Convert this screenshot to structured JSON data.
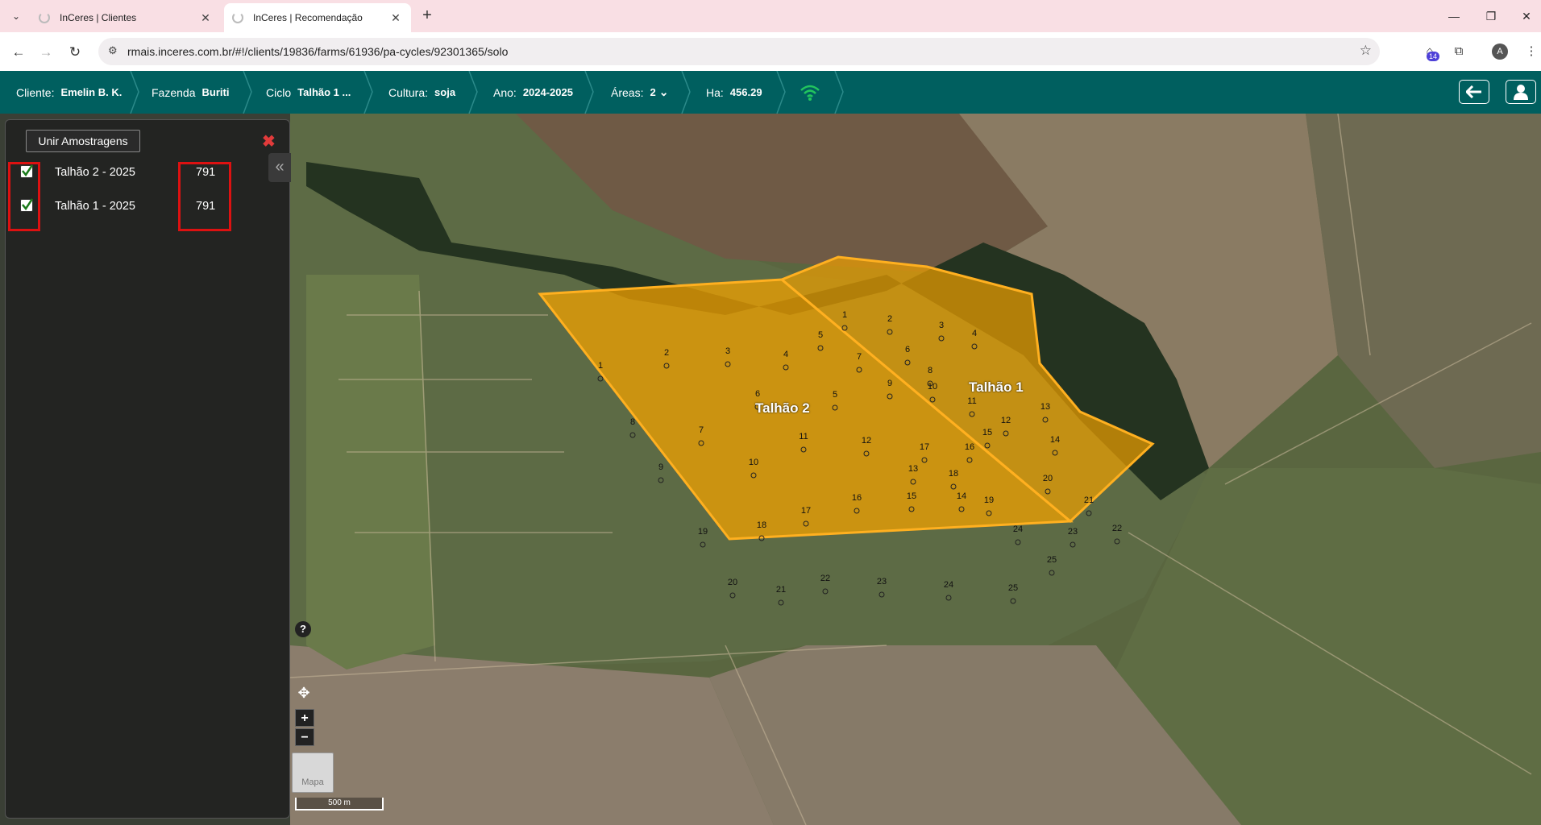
{
  "browser": {
    "tabs": [
      {
        "title": "InCeres | Clientes",
        "active": false
      },
      {
        "title": "InCeres | Recomendação",
        "active": true
      }
    ],
    "url": "rmais.inceres.com.br/#!/clients/19836/farms/61936/pa-cycles/92301365/solo",
    "extensions_badge": "14",
    "profile_initial": "A"
  },
  "header": {
    "cliente_label": "Cliente:",
    "cliente_value": "Emelin B. K.",
    "fazenda_label": "Fazenda",
    "fazenda_value": "Buriti",
    "ciclo_label": "Ciclo",
    "ciclo_value": "Talhão 1 ...",
    "cultura_label": "Cultura:",
    "cultura_value": "soja",
    "ano_label": "Ano:",
    "ano_value": "2024-2025",
    "areas_label": "Áreas:",
    "areas_value": "2",
    "ha_label": "Ha:",
    "ha_value": "456.29",
    "connection_icon": "wifi-icon",
    "connection_color": "#22c55e"
  },
  "panel": {
    "merge_button": "Unir Amostragens",
    "items": [
      {
        "label": "Talhão 2 - 2025",
        "value": "791",
        "checked": true
      },
      {
        "label": "Talhão 1 - 2025",
        "value": "791",
        "checked": true
      }
    ]
  },
  "map": {
    "fields": [
      {
        "name": "Talhão 2",
        "points": [
          "1",
          "2",
          "3",
          "4",
          "5",
          "6",
          "7",
          "8",
          "9",
          "10",
          "11",
          "12",
          "13",
          "14",
          "15",
          "16",
          "17",
          "18",
          "19",
          "20",
          "21",
          "22",
          "23",
          "24",
          "25"
        ]
      },
      {
        "name": "Talhão 1",
        "points": [
          "1",
          "2",
          "3",
          "4",
          "5",
          "6",
          "7",
          "8",
          "9",
          "10",
          "11",
          "12",
          "13",
          "14",
          "15",
          "16",
          "17",
          "18",
          "19",
          "20",
          "21",
          "22",
          "23",
          "24",
          "25"
        ]
      }
    ],
    "field_color": "#f0a000",
    "help": "?",
    "zoom_in": "+",
    "zoom_out": "−",
    "map_type": "Mapa",
    "scale": "500 m"
  }
}
